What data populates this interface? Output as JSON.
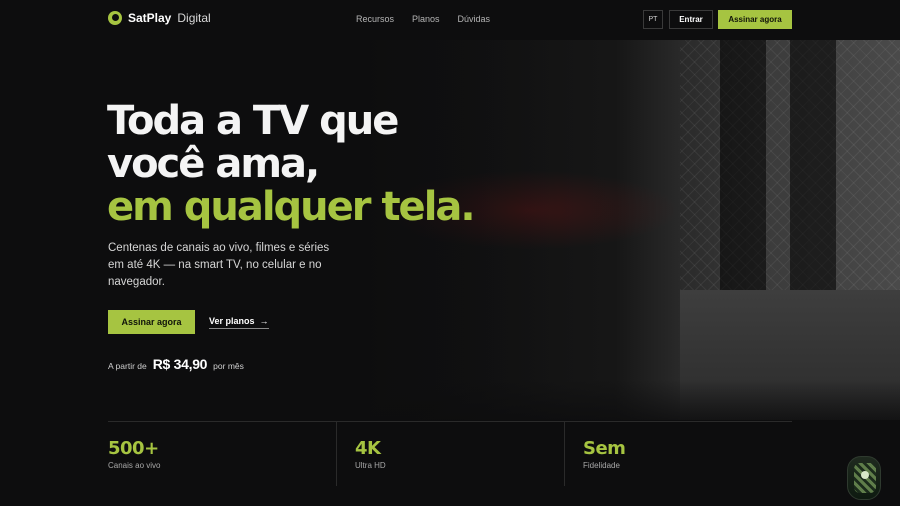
{
  "nav": {
    "brand_name": "SatPlay",
    "brand_sub": "Digital",
    "links": [
      "Recursos",
      "Planos",
      "Dúvidas"
    ],
    "lang": "PT",
    "login": "Entrar",
    "subscribe": "Assinar agora"
  },
  "hero": {
    "title_line1": "Toda a TV que você ama,",
    "title_accent": "em qualquer tela.",
    "description": "Centenas de canais ao vivo, filmes e séries em até 4K — na smart TV, no celular e no navegador.",
    "cta_primary": "Assinar agora",
    "cta_secondary": "Ver planos",
    "price_prefix": "A partir de",
    "price_value": "R$ 34,90",
    "price_suffix": "por mês"
  },
  "stats": [
    {
      "value": "500+",
      "label": "Canais ao vivo"
    },
    {
      "value": "4K",
      "label": "Ultra HD"
    },
    {
      "value": "Sem",
      "label": "Fidelidade"
    }
  ],
  "colors": {
    "accent": "#a6c441",
    "background": "#0d0d0e"
  },
  "icons": {
    "logo": "satplay-logo-icon",
    "arrow": "arrow-right-icon"
  }
}
